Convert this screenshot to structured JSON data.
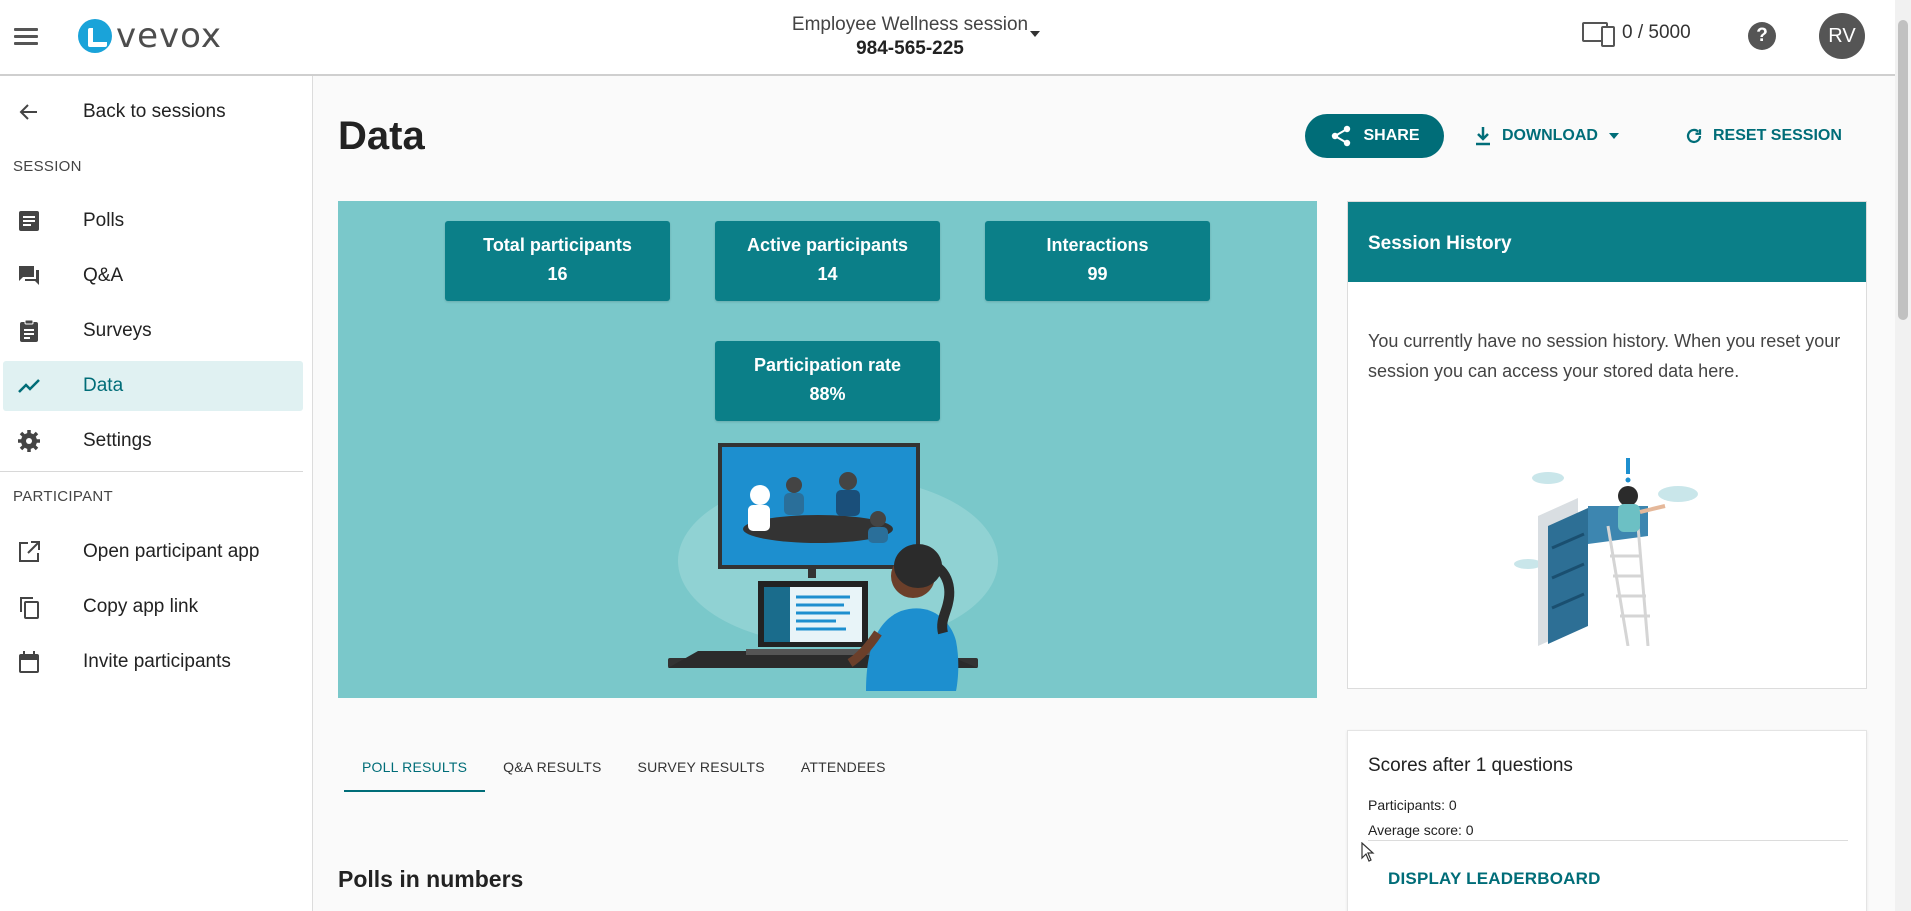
{
  "header": {
    "logo_text": "vevox",
    "session_name": "Employee Wellness session",
    "session_code": "984-565-225",
    "device_count": "0 / 5000",
    "help_glyph": "?",
    "avatar_initials": "RV"
  },
  "sidebar": {
    "back_label": "Back to sessions",
    "session_section": "SESSION",
    "session_items": [
      {
        "label": "Polls",
        "icon": "polls-icon"
      },
      {
        "label": "Q&A",
        "icon": "qa-icon"
      },
      {
        "label": "Surveys",
        "icon": "surveys-icon"
      },
      {
        "label": "Data",
        "icon": "data-icon",
        "active": true
      },
      {
        "label": "Settings",
        "icon": "gear-icon"
      }
    ],
    "participant_section": "PARTICIPANT",
    "participant_items": [
      {
        "label": "Open participant app",
        "icon": "open-external-icon"
      },
      {
        "label": "Copy app link",
        "icon": "copy-icon"
      },
      {
        "label": "Invite participants",
        "icon": "calendar-icon"
      }
    ]
  },
  "main": {
    "title": "Data",
    "share_label": "SHARE",
    "download_label": "DOWNLOAD",
    "reset_label": "RESET SESSION",
    "stats": [
      {
        "title": "Total participants",
        "value": "16"
      },
      {
        "title": "Active participants",
        "value": "14"
      },
      {
        "title": "Interactions",
        "value": "99"
      },
      {
        "title": "Participation rate",
        "value": "88%"
      }
    ],
    "tabs": [
      "POLL RESULTS",
      "Q&A RESULTS",
      "SURVEY RESULTS",
      "ATTENDEES"
    ],
    "active_tab": "POLL RESULTS",
    "section_heading": "Polls in numbers"
  },
  "history": {
    "title": "Session History",
    "text": "You currently have no session history. When you reset your session you can access your stored data here."
  },
  "scores": {
    "title": "Scores after 1 questions",
    "participants": "Participants: 0",
    "average": "Average score: 0",
    "leaderboard_label": "DISPLAY LEADERBOARD"
  },
  "colors": {
    "brand": "#006d78",
    "card": "#0b7f88",
    "hero_bg": "#7ac8ca",
    "active_nav_bg": "#e0f1f2"
  }
}
